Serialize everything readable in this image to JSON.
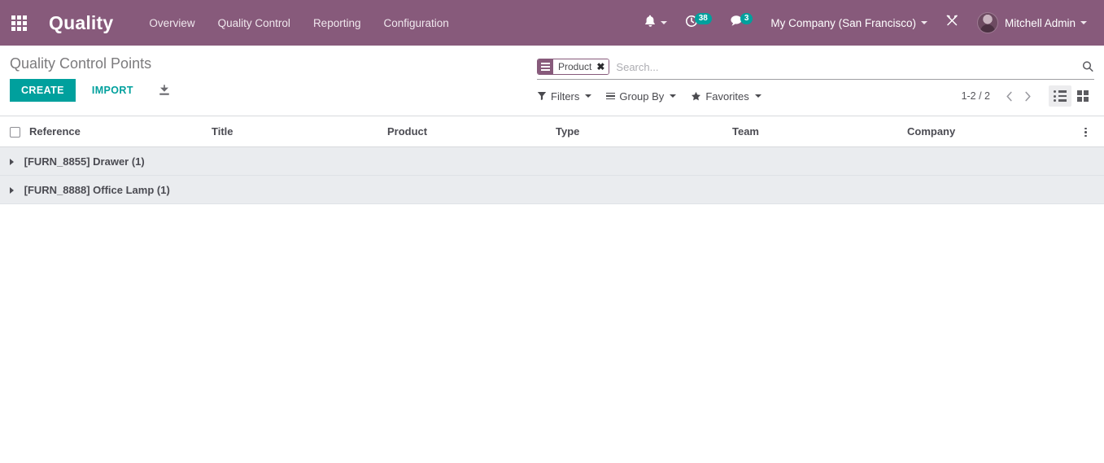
{
  "navbar": {
    "apps_icon": "apps-grid-icon",
    "brand": "Quality",
    "menu": [
      {
        "label": "Overview"
      },
      {
        "label": "Quality Control"
      },
      {
        "label": "Reporting"
      },
      {
        "label": "Configuration"
      }
    ],
    "bell_icon": "bell-icon",
    "activity_icon": "clock-activity-icon",
    "activity_count": "38",
    "messages_icon": "messages-icon",
    "messages_count": "3",
    "company": "My Company (San Francisco)",
    "debug_icon": "tools-debug-icon",
    "avatar": "user-avatar",
    "user": "Mitchell Admin",
    "bg_color": "#875a7b",
    "badge_color": "#00a09d"
  },
  "control_panel": {
    "breadcrumb": "Quality Control Points",
    "create_label": "CREATE",
    "import_label": "IMPORT",
    "export_icon": "download-export-icon",
    "create_color": "#00a09d"
  },
  "search": {
    "facet": {
      "icon": "group-by-icon",
      "label": "Product",
      "remove": "✖"
    },
    "placeholder": "Search...",
    "value": "",
    "search_icon": "search-icon"
  },
  "filters": {
    "filters_label": "Filters",
    "filters_icon": "funnel-icon",
    "group_by_label": "Group By",
    "group_by_icon": "bars-icon",
    "favorites_label": "Favorites",
    "favorites_icon": "star-icon"
  },
  "pager": {
    "range": "1-2 / 2",
    "prev_icon": "chevron-left-icon",
    "next_icon": "chevron-right-icon",
    "prev": "‹",
    "next": "›",
    "views": [
      {
        "name": "list",
        "icon": "list-view-icon",
        "active": true
      },
      {
        "name": "kanban",
        "icon": "kanban-view-icon",
        "active": false
      }
    ]
  },
  "table": {
    "columns": [
      "Reference",
      "Title",
      "Product",
      "Type",
      "Team",
      "Company"
    ],
    "select_all_icon": "checkbox-select-all",
    "optional_columns_icon": "optional-columns-icon",
    "groups": [
      {
        "label": "[FURN_8855] Drawer (1)",
        "expanded": false
      },
      {
        "label": "[FURN_8888] Office Lamp (1)",
        "expanded": false
      }
    ]
  }
}
